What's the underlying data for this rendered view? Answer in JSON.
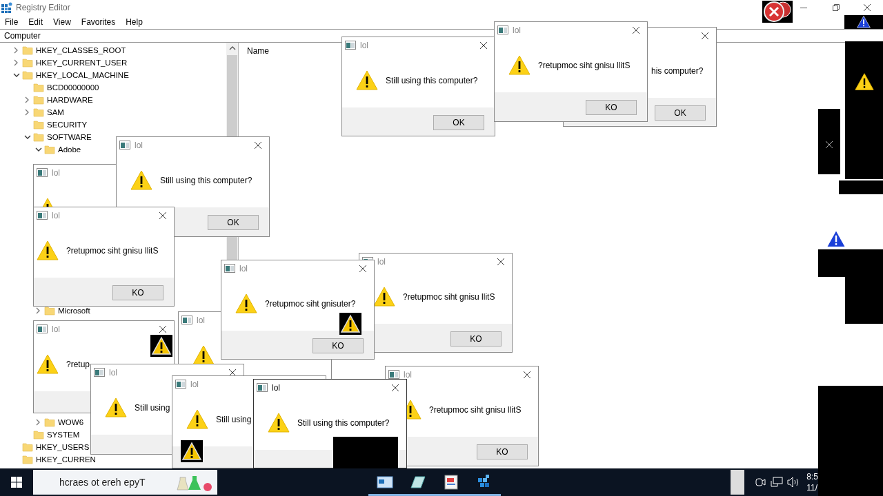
{
  "registry_window": {
    "title": "Registry Editor",
    "menu": [
      "File",
      "Edit",
      "View",
      "Favorites",
      "Help"
    ],
    "address": "Computer",
    "tree": [
      {
        "label": "HKEY_CLASSES_ROOT",
        "expanded": false
      },
      {
        "label": "HKEY_CURRENT_USER",
        "expanded": false
      },
      {
        "label": "HKEY_LOCAL_MACHINE",
        "expanded": true,
        "children": [
          {
            "label": "BCD00000000"
          },
          {
            "label": "HARDWARE",
            "expanded": false
          },
          {
            "label": "SAM",
            "expanded": false
          },
          {
            "label": "SECURITY"
          },
          {
            "label": "SOFTWARE",
            "expanded": true,
            "children": [
              {
                "label": "Adobe",
                "expanded": true
              },
              {
                "label": "Microsoft",
                "expanded": false
              },
              {
                "label": "WOW6",
                "expanded": false
              }
            ]
          },
          {
            "label": "SYSTEM"
          }
        ]
      },
      {
        "label": "HKEY_USERS"
      },
      {
        "label": "HKEY_CURREN"
      }
    ],
    "list_columns": [
      "Name"
    ]
  },
  "dialogs": [
    {
      "title": "lol",
      "active": false,
      "close": false
    },
    {
      "title": "lol",
      "active": false,
      "close": true,
      "message": "Still using this computer?",
      "button": "OK"
    },
    {
      "title": "lol",
      "active": false,
      "close": true,
      "message": "?retupmoc siht gnisu llitS",
      "button": "KO"
    },
    {
      "title": "lol",
      "active": false,
      "close": true,
      "message": "?retupmoc siht gnisu llitS",
      "button": "KO"
    },
    {
      "title": "lol",
      "active": false,
      "close": false
    },
    {
      "title": "lol",
      "active": false,
      "close": true,
      "message": "?retupmoc siht gnisuter?",
      "button": "KO",
      "overlay": true
    },
    {
      "title": "lol",
      "active": false,
      "close": true,
      "message": "?retup",
      "overlay": true
    },
    {
      "title": "lol",
      "active": false,
      "close": true,
      "message": "Still using"
    },
    {
      "title": "lol",
      "active": false,
      "close": false,
      "message": "Still using",
      "overlay": true
    },
    {
      "title": "lol",
      "active": false,
      "close": true,
      "message": "?retupmoc siht gnisu llitS",
      "button": "KO"
    },
    {
      "title": "lol",
      "active": true,
      "close": true,
      "message": "Still using this computer?"
    },
    {
      "title": "lol",
      "active": false,
      "close": true,
      "message": "Still using this computer?",
      "button": "OK"
    },
    {
      "active": false,
      "close": true,
      "message": "his computer?",
      "button": "OK"
    },
    {
      "title": "lol",
      "active": false,
      "close": true,
      "message": "?retupmoc siht gnisu llitS",
      "button": "KO"
    }
  ],
  "taskbar": {
    "search": {
      "placeholder": "hcraes ot ereh epyT"
    },
    "clock": {
      "time": "8:5",
      "date": "11/"
    }
  }
}
